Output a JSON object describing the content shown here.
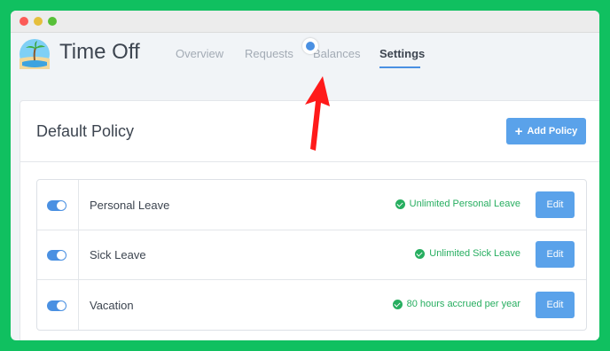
{
  "app": {
    "title": "Time Off",
    "logo_icon": "beach-island-icon"
  },
  "nav": {
    "tabs": [
      {
        "label": "Overview",
        "active": false
      },
      {
        "label": "Requests",
        "active": false
      },
      {
        "label": "Balances",
        "active": false
      },
      {
        "label": "Settings",
        "active": true
      }
    ]
  },
  "panel": {
    "title": "Default Policy",
    "add_button": {
      "icon": "plus-icon",
      "label": "Add Policy"
    },
    "policies": [
      {
        "name": "Personal Leave",
        "enabled": true,
        "status": "Unlimited Personal Leave",
        "edit_label": "Edit"
      },
      {
        "name": "Sick Leave",
        "enabled": true,
        "status": "Unlimited Sick Leave",
        "edit_label": "Edit"
      },
      {
        "name": "Vacation",
        "enabled": true,
        "status": "80 hours accrued per year",
        "edit_label": "Edit"
      }
    ]
  },
  "colors": {
    "background": "#10c060",
    "accent": "#5aa2ea",
    "success": "#27ae60",
    "annotation_arrow": "#ff1a1a"
  }
}
